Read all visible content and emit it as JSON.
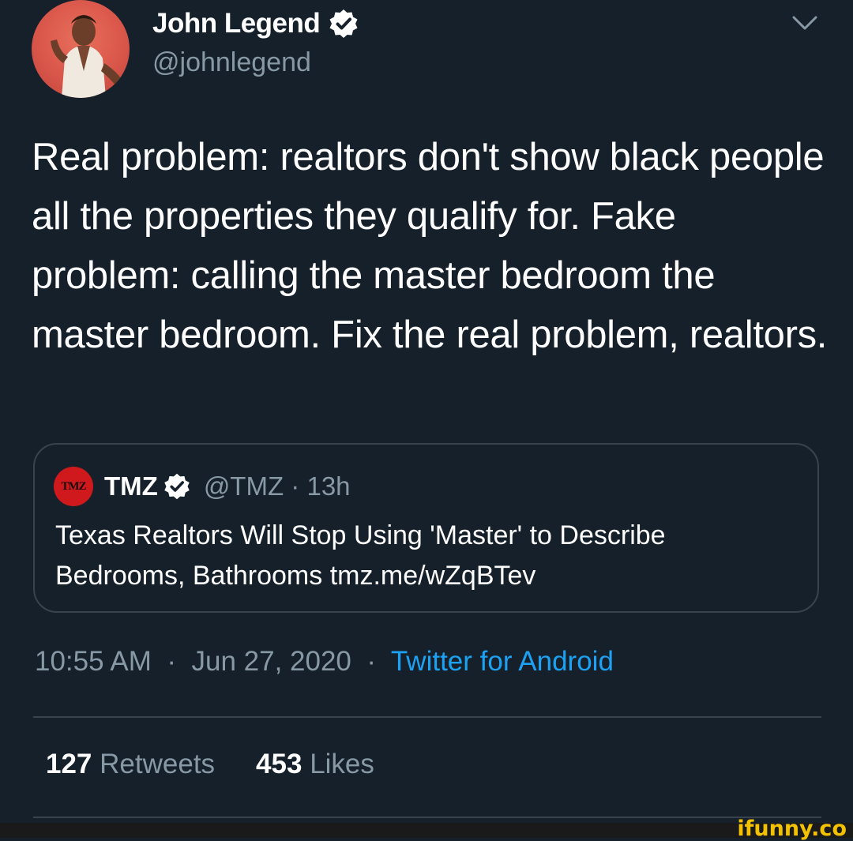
{
  "tweet": {
    "author_name": "John Legend",
    "author_handle": "@johnlegend",
    "avatar_icon": "profile-photo",
    "text": "Real problem: realtors don't show black people all the properties they qualify for. Fake problem: calling the master bedroom the master bedroom. Fix the real problem, realtors.",
    "time": "10:55 AM",
    "date": "Jun 27, 2020",
    "separator": "·",
    "source": "Twitter for Android"
  },
  "quoted_tweet": {
    "logo_text": "TMZ",
    "author_name": "TMZ",
    "author_handle": "@TMZ",
    "age": "13h",
    "text": "Texas Realtors Will Stop Using 'Master' to Describe Bedrooms, Bathrooms tmz.me/wZqBTev"
  },
  "stats": {
    "retweets_count": "127",
    "retweets_label": "Retweets",
    "likes_count": "453",
    "likes_label": "Likes"
  },
  "watermark": "ifunny.co",
  "colors": {
    "background": "#15202b",
    "secondary_text": "#8899a6",
    "link": "#1da1f2",
    "border": "#38444d",
    "watermark": "#f2c200"
  }
}
